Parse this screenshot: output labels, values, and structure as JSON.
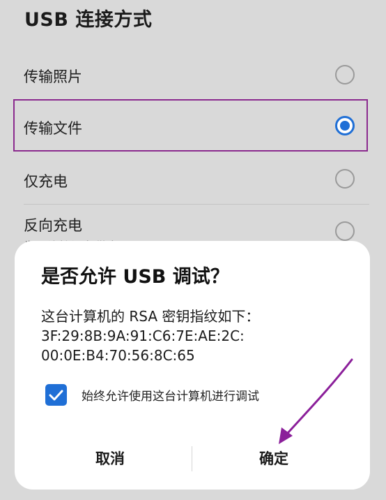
{
  "background_screen": {
    "title": "USB 连接方式",
    "options": [
      {
        "label": "传输照片",
        "selected": false
      },
      {
        "label": "传输文件",
        "selected": true
      },
      {
        "label": "仅充电",
        "selected": false
      },
      {
        "label": "反向充电",
        "selected": false
      }
    ],
    "reverse_charge_subtitle": "为已连接设备供电"
  },
  "dialog": {
    "title": "是否允许 USB 调试？",
    "message_line1": "这台计算机的 RSA 密钥指纹如下：",
    "fingerprint_line1": "3F:29:8B:9A:91:C6:7E:AE:2C:",
    "fingerprint_line2": "00:0E:B4:70:56:8C:65",
    "always_allow": {
      "label": "始终允许使用这台计算机进行调试",
      "checked": true
    },
    "cancel_label": "取消",
    "confirm_label": "确定"
  },
  "colors": {
    "accent": "#1f6fd6",
    "highlight_box": "#8b2a8e",
    "arrow": "#8b1f9a",
    "scrim_background": "#d9d9d9"
  }
}
